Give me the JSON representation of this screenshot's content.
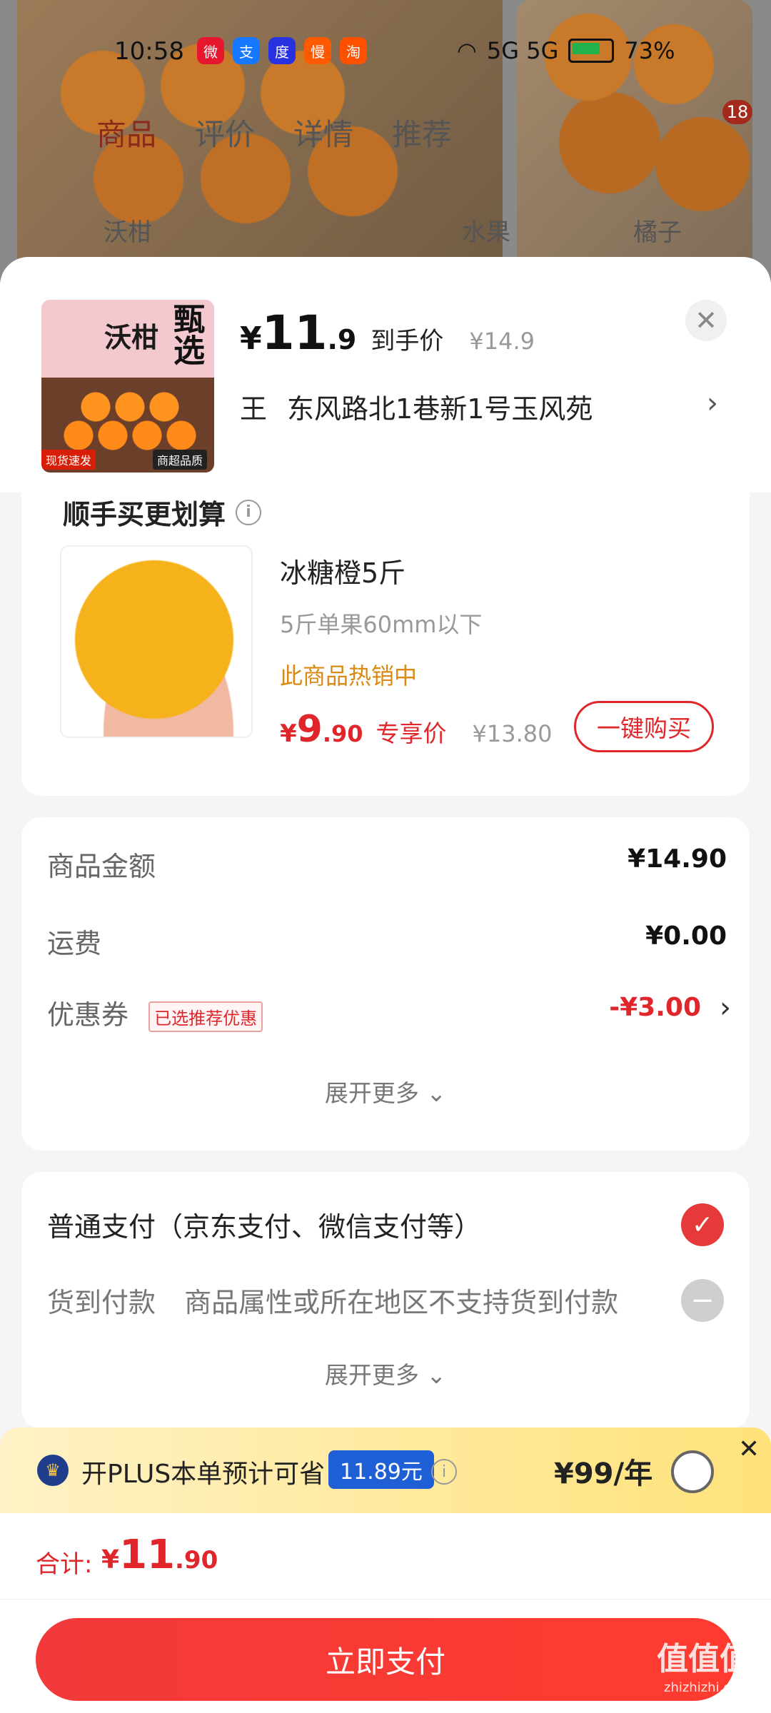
{
  "status_bar": {
    "time": "10:58",
    "apps": [
      "微",
      "支",
      "度",
      "慢",
      "淘"
    ],
    "network": "5G 5G",
    "battery": "73%"
  },
  "background_page": {
    "tabs": [
      "商品",
      "评价",
      "详情",
      "推荐"
    ],
    "categories": [
      "沃柑",
      "水果",
      "橘子"
    ],
    "badge_count": "18"
  },
  "product": {
    "thumb_text": "沃柑",
    "thumb_pick": "甄选",
    "thumb_tag": "商超品质",
    "thumb_tag_left": "现货速发",
    "price_symbol": "¥",
    "price_int": "11",
    "price_dec": ".9",
    "price_label": "到手价",
    "original_price": "¥14.9"
  },
  "address": {
    "name": "王",
    "detail": "东风路北1巷新1号玉风苑"
  },
  "upsell": {
    "title": "顺手买更划算",
    "item_name": "冰糖橙5斤",
    "item_spec": "5斤单果60mm以下",
    "item_hot": "此商品热销中",
    "price_symbol": "¥",
    "price_int": "9",
    "price_dec": ".90",
    "price_label": "专享价",
    "original_price": "¥13.80",
    "buy_button": "一键购买"
  },
  "summary": {
    "goods_label": "商品金额",
    "goods_value": "¥14.90",
    "shipping_label": "运费",
    "shipping_value": "¥0.00",
    "coupon_label": "优惠券",
    "coupon_tag": "已选推荐优惠",
    "coupon_value": "-¥3.00",
    "expand_more": "展开更多"
  },
  "payment": {
    "normal_label": "普通支付（京东支付、微信支付等）",
    "cod_label": "货到付款",
    "cod_note": "商品属性或所在地区不支持货到付款",
    "expand_more": "展开更多"
  },
  "plus": {
    "text": "开PLUS本单预计可省",
    "save_amount": "11.89元",
    "price": "¥99/年"
  },
  "total": {
    "label": "合计:",
    "price_symbol": "¥",
    "price_int": "11",
    "price_dec": ".90"
  },
  "pay_button": "立即支付",
  "watermark": {
    "text": "值值值",
    "sub": "zhizhizhi.com"
  },
  "colors": {
    "accent_red": "#e0262b",
    "hot_orange": "#d98a14",
    "plus_blue": "#1f5fd6"
  }
}
